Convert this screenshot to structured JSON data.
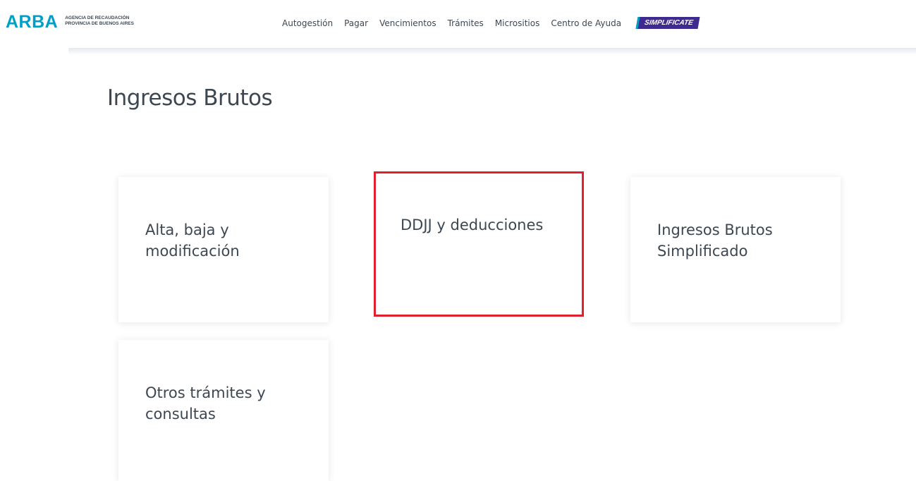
{
  "header": {
    "logo_mark": "ARBA",
    "logo_sub_line1": "Agencia de Recaudación",
    "logo_sub_line2": "Provincia de Buenos Aires",
    "nav": [
      {
        "label": "Autogestión"
      },
      {
        "label": "Pagar"
      },
      {
        "label": "Vencimientos"
      },
      {
        "label": "Trámites"
      },
      {
        "label": "Micrositios"
      },
      {
        "label": "Centro de Ayuda"
      }
    ],
    "badge_label": "SIMPLIFICATE"
  },
  "main": {
    "title": "Ingresos Brutos",
    "cards": [
      {
        "label": "Alta, baja y modificación"
      },
      {
        "label": "DDJJ y deducciones",
        "highlighted": true
      },
      {
        "label": "Ingresos Brutos Simplificado"
      },
      {
        "label": "Otros trámites y consultas"
      }
    ]
  },
  "colors": {
    "brand_blue": "#00a0c6",
    "badge_purple": "#3f2a8f",
    "highlight_red": "#e1202e",
    "text_dark": "#3d4752"
  }
}
